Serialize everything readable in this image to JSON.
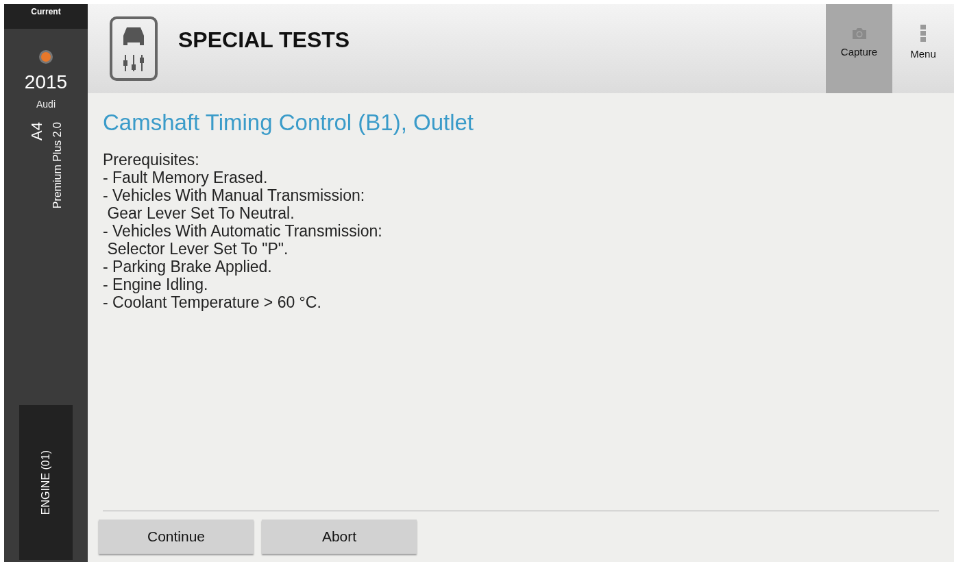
{
  "sidebar": {
    "label": "Current",
    "year": "2015",
    "make": "Audi",
    "model": "A4",
    "trim": "Premium Plus 2.0",
    "module": "ENGINE (01)"
  },
  "header": {
    "title": "SPECIAL TESTS",
    "actions": [
      {
        "kind": "camera",
        "label": "Capture",
        "selected": true
      },
      {
        "kind": "menu",
        "label": "Menu",
        "selected": false
      }
    ]
  },
  "content": {
    "heading": "Camshaft Timing Control (B1), Outlet",
    "lines": [
      "Prerequisites:",
      "- Fault Memory Erased.",
      "- Vehicles With Manual Transmission:",
      " Gear Lever Set To Neutral.",
      "- Vehicles With Automatic Transmission:",
      " Selector Lever Set To \"P\".",
      "- Parking Brake Applied.",
      "- Engine Idling.",
      "- Coolant Temperature > 60 °C."
    ]
  },
  "buttons": [
    "Continue",
    "Abort"
  ]
}
